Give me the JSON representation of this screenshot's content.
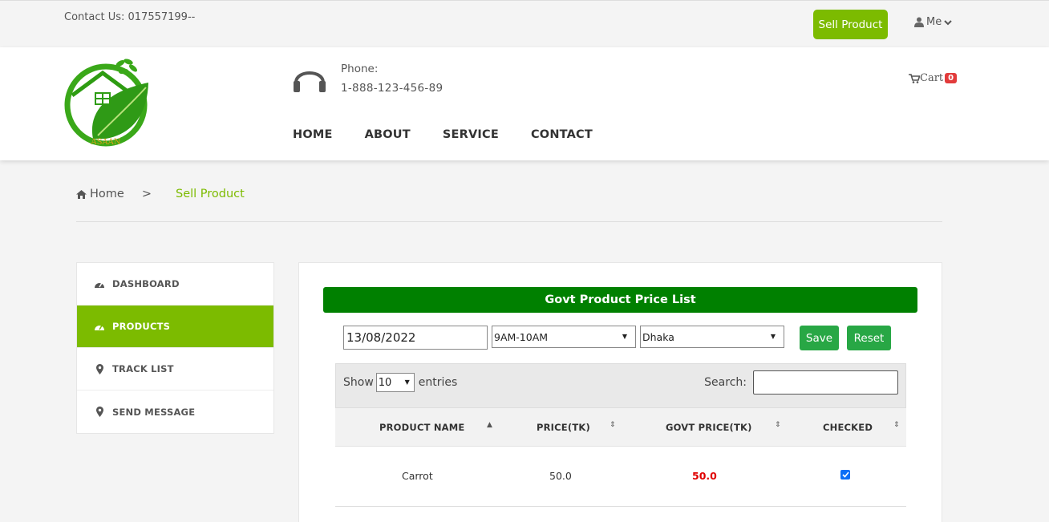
{
  "topbar": {
    "contact": "Contact Us: 017557199--",
    "sell_button": "Sell Product",
    "user_menu": "Me"
  },
  "header": {
    "logo_text": "ASAAN",
    "phone_label": "Phone:",
    "phone_number": "1-888-123-456-89",
    "nav": [
      "HOME",
      "ABOUT",
      "SERVICE",
      "CONTACT"
    ],
    "cart_label": "Cart",
    "cart_count": "0"
  },
  "breadcrumb": {
    "home": "Home",
    "separator": ">",
    "current": "Sell Product"
  },
  "sidebar": {
    "items": [
      {
        "label": "DASHBOARD",
        "icon": "dashboard-icon"
      },
      {
        "label": "PRODUCTS",
        "icon": "dashboard-icon"
      },
      {
        "label": "TRACK LIST",
        "icon": "map-marker-icon"
      },
      {
        "label": "SEND MESSAGE",
        "icon": "map-marker-icon"
      }
    ],
    "active_index": 1
  },
  "panel": {
    "title": "Govt Product Price List",
    "date_value": "13/08/2022",
    "time_slot": "9AM-10AM",
    "city": "Dhaka",
    "save_label": "Save",
    "reset_label": "Reset"
  },
  "table": {
    "show_label": "Show",
    "entries_value": "10",
    "entries_label": "entries",
    "search_label": "Search:",
    "headers": [
      "PRODUCT NAME",
      "PRICE(TK)",
      "GOVT PRICE(TK)",
      "CHECKED"
    ],
    "rows": [
      {
        "product_name": "Carrot",
        "price": "50.0",
        "govt_price": "50.0",
        "checked": true
      }
    ]
  },
  "colors": {
    "brand_green": "#7cbb00",
    "title_green": "#008000",
    "button_green": "#28a745",
    "govt_price_red": "#e00000",
    "badge_red": "#e23b3b"
  }
}
